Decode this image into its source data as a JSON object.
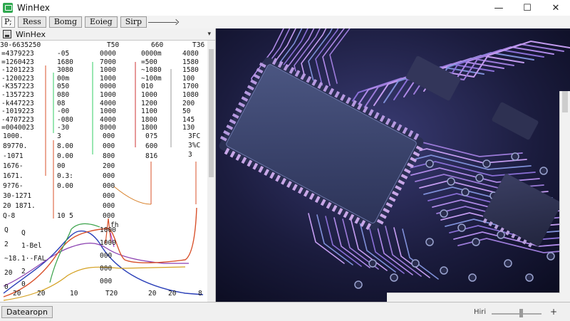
{
  "window": {
    "title": "WinHex",
    "controls": {
      "minimize": "—",
      "maximize": "☐",
      "close": "✕"
    }
  },
  "toolbar": {
    "buttons": [
      "P;",
      "Ress",
      "Bomg",
      "Eoieg",
      "Sirp"
    ]
  },
  "panel": {
    "title": "WinHex",
    "dropdown_icon": "▾"
  },
  "hex": {
    "header": [
      "30-6635250",
      "T50",
      "660",
      "T36"
    ],
    "rows": [
      [
        "=4379223",
        "-05",
        "0000",
        "0000m",
        "4080"
      ],
      [
        "=1260423",
        "1680",
        "7000",
        "=500",
        "1580"
      ],
      [
        "-1201223",
        "3080",
        "1000",
        "~1080",
        "1580"
      ],
      [
        "-1200223",
        "00m",
        "1000",
        "~100m",
        "100"
      ],
      [
        "-K357223",
        "050",
        "0000",
        "010",
        "1700"
      ],
      [
        "-1357223",
        "080",
        "1000",
        "1000",
        "1080"
      ],
      [
        "-k447223",
        "08",
        "4000",
        "1200",
        "200"
      ],
      [
        "-1019223",
        "-00",
        "1000",
        "1100",
        "50"
      ],
      [
        "-4707223",
        "-080",
        "4000",
        "1800",
        "145"
      ],
      [
        "=0040023",
        "-30",
        "8000",
        "1800",
        "130"
      ]
    ],
    "lower_labels": [
      "1000.",
      "89770.",
      "-1071",
      "1676-",
      "1671.",
      "9?76-",
      "30-1271",
      "20 1871.",
      "Q-8"
    ],
    "lower_values": [
      [
        "3",
        "000",
        "0?5"
      ],
      [
        "8.00",
        "000",
        "600"
      ],
      [
        "0.00",
        "800",
        "816"
      ],
      [
        "00",
        "200",
        ""
      ],
      [
        "0.3:",
        "000",
        ""
      ],
      [
        "0.00",
        "000",
        ""
      ],
      [
        "",
        "000",
        ""
      ],
      [
        "",
        "000",
        ""
      ],
      [
        "10 5",
        "000",
        ""
      ]
    ],
    "right_extra": [
      "3FC",
      "3%C",
      "3"
    ],
    "chart_rows": [
      [
        "Q",
        "1000"
      ],
      [
        "1-Bel",
        "1000"
      ],
      [
        "1·-FAL",
        "000"
      ],
      [
        "2",
        "000"
      ],
      [
        "0",
        "000"
      ]
    ],
    "chart_left_labels": [
      "Q",
      "2",
      "~18.",
      "20",
      "0"
    ],
    "peak_label": "fh",
    "x_labels": [
      "20",
      "20",
      "10",
      "T20",
      "20",
      "20",
      "8"
    ]
  },
  "status": {
    "button": "Datearopn",
    "zoom_label": "Hiri",
    "zoom_plus": "+"
  }
}
